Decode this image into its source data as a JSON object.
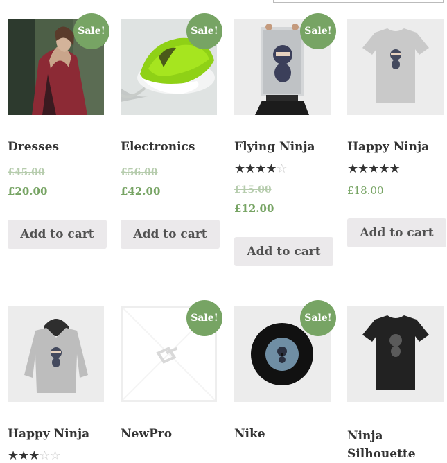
{
  "products": [
    {
      "title": "Dresses",
      "sale": "Sale!",
      "price_old": "£45.00",
      "price_new": "£20.00",
      "button": "Add to cart"
    },
    {
      "title": "Electronics",
      "sale": "Sale!",
      "price_old": "£56.00",
      "price_new": "£42.00",
      "button": "Add to cart"
    },
    {
      "title": "Flying Ninja",
      "sale": "Sale!",
      "rating": 4,
      "rating_max": 5,
      "price_old": "£15.00",
      "price_new": "£12.00",
      "button": "Add to cart"
    },
    {
      "title": "Happy Ninja",
      "rating": 5,
      "rating_max": 5,
      "price": "£18.00",
      "button": "Add to cart"
    },
    {
      "title": "Happy Ninja",
      "rating": 3,
      "rating_max": 5
    },
    {
      "title": "NewPro",
      "sale": "Sale!"
    },
    {
      "title": "Nike",
      "sale": "Sale!"
    },
    {
      "title": "Ninja Silhouette"
    }
  ],
  "colors": {
    "sale_badge": "#77a464",
    "price": "#77a464",
    "button_bg": "#ebe9eb"
  }
}
